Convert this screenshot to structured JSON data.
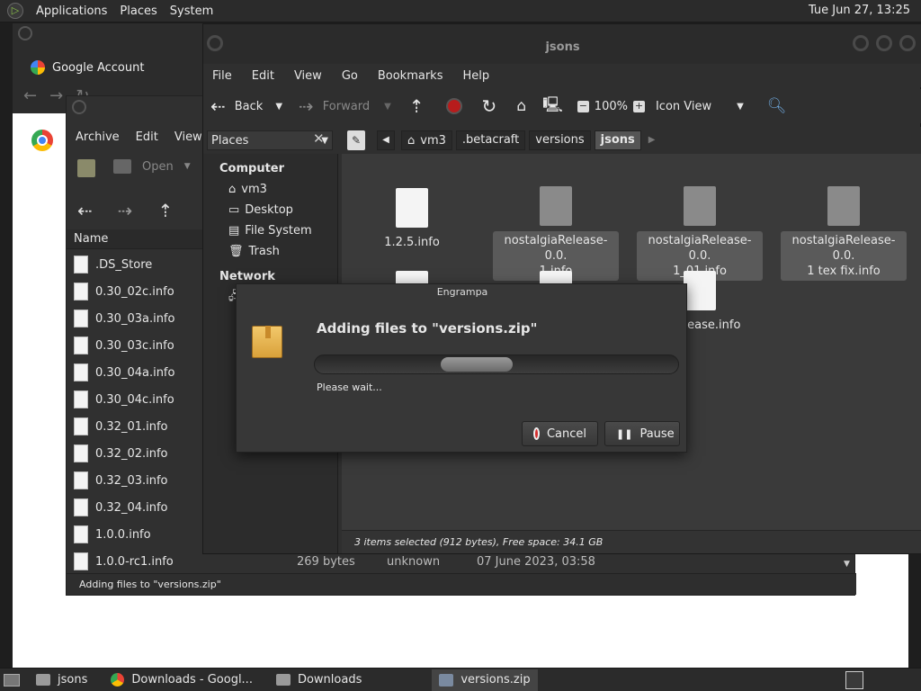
{
  "top_panel": {
    "menus": [
      "Applications",
      "Places",
      "System"
    ],
    "clock": "Tue Jun 27, 13:25"
  },
  "chrome": {
    "tab_title": "Google Account"
  },
  "file_roller": {
    "menus": [
      "Archive",
      "Edit",
      "View"
    ],
    "open_label": "Open",
    "column_name": "Name",
    "files": [
      {
        "name": ".DS_Store"
      },
      {
        "name": "0.30_02c.info"
      },
      {
        "name": "0.30_03a.info"
      },
      {
        "name": "0.30_03c.info"
      },
      {
        "name": "0.30_04a.info"
      },
      {
        "name": "0.30_04c.info"
      },
      {
        "name": "0.32_01.info"
      },
      {
        "name": "0.32_02.info"
      },
      {
        "name": "0.32_03.info"
      },
      {
        "name": "0.32_04.info"
      },
      {
        "name": "1.0.0.info"
      },
      {
        "name": "1.0.0-rc1.info",
        "size": "269 bytes",
        "type": "unknown",
        "date": "07 June 2023, 03:58"
      }
    ],
    "status": "Adding files to \"versions.zip\""
  },
  "caja": {
    "title": "jsons",
    "menus": [
      "File",
      "Edit",
      "View",
      "Go",
      "Bookmarks",
      "Help"
    ],
    "toolbar": {
      "back": "Back",
      "forward": "Forward",
      "zoom": "100%",
      "view_mode": "Icon View"
    },
    "places_label": "Places",
    "breadcrumb": [
      "vm3",
      ".betacraft",
      "versions",
      "jsons"
    ],
    "sidebar": {
      "computer_header": "Computer",
      "computer_items": [
        "vm3",
        "Desktop",
        "File System",
        "Trash"
      ],
      "network_header": "Network"
    },
    "files": [
      {
        "name": "1.2.5.info",
        "selected": false
      },
      {
        "name": "nostalgiaRelease-0.0.1.info",
        "label1": "nostalgiaRelease-0.0.",
        "label2": "1.info",
        "selected": true
      },
      {
        "name": "nostalgiaRelease-0.0.1_01.info",
        "label1": "nostalgiaRelease-0.0.",
        "label2": "1_01.info",
        "selected": true
      },
      {
        "name": "nostalgiaRelease-0.0.1 tex fix.info",
        "label1": "nostalgiaRelease-0.0.",
        "label2": "1 tex fix.info",
        "selected": true
      },
      {
        "name": "",
        "selected": false
      },
      {
        "name": "",
        "selected": false
      },
      {
        "name": "iaRelease.info",
        "selected": false
      }
    ],
    "status": "3 items selected (912 bytes), Free space: 34.1 GB"
  },
  "dialog": {
    "title": "Engrampa",
    "heading": "Adding files to \"versions.zip\"",
    "wait_text": "Please wait...",
    "cancel": "Cancel",
    "pause": "Pause"
  },
  "taskbar": {
    "items": [
      {
        "label": "jsons",
        "icon": "folder-icon",
        "active": false
      },
      {
        "label": "Downloads - Googl...",
        "icon": "chrome-icon",
        "active": false
      },
      {
        "label": "Downloads",
        "icon": "folder-icon",
        "active": false
      },
      {
        "label": "versions.zip",
        "icon": "archive-icon",
        "active": true
      }
    ]
  }
}
